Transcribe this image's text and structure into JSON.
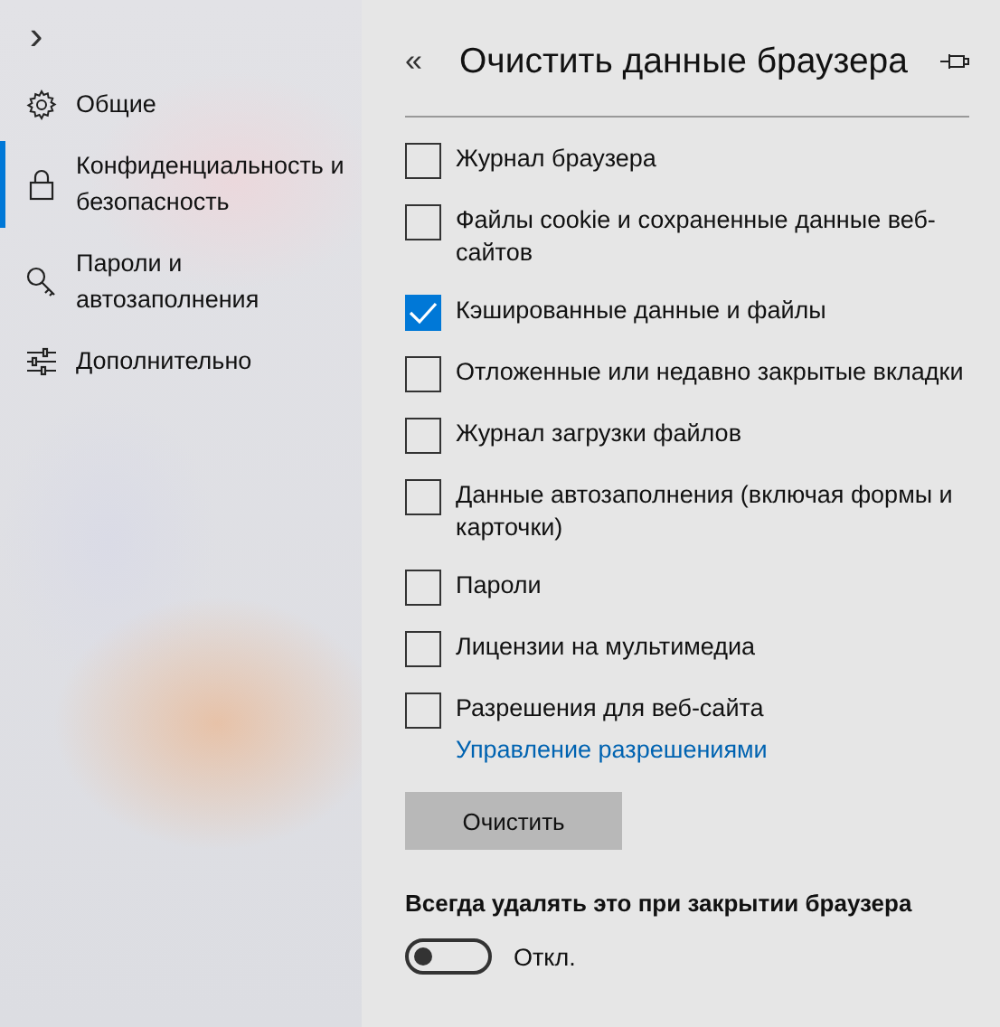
{
  "sidebar": {
    "expand_glyph": "›",
    "items": [
      {
        "label": "Общие",
        "selected": false
      },
      {
        "label": "Конфиденциальность и безопасность",
        "selected": true
      },
      {
        "label": "Пароли и автозаполнения",
        "selected": false
      },
      {
        "label": "Дополнительно",
        "selected": false
      }
    ]
  },
  "panel": {
    "back_glyph": "«",
    "title": "Очистить данные браузера",
    "options": [
      {
        "label": "Журнал браузера",
        "checked": false
      },
      {
        "label": "Файлы cookie и сохраненные данные веб-сайтов",
        "checked": false
      },
      {
        "label": "Кэшированные данные и файлы",
        "checked": true
      },
      {
        "label": "Отложенные или недавно закрытые вкладки",
        "checked": false
      },
      {
        "label": "Журнал загрузки файлов",
        "checked": false
      },
      {
        "label": "Данные автозаполнения (включая формы и карточки)",
        "checked": false
      },
      {
        "label": "Пароли",
        "checked": false
      },
      {
        "label": "Лицензии на мультимедиа",
        "checked": false
      },
      {
        "label": "Разрешения для веб-сайта",
        "checked": false
      }
    ],
    "link": "Управление разрешениями",
    "button": "Очистить",
    "always_label": "Всегда удалять это при закрытии браузера",
    "toggle": {
      "on": false,
      "label": "Откл."
    }
  }
}
